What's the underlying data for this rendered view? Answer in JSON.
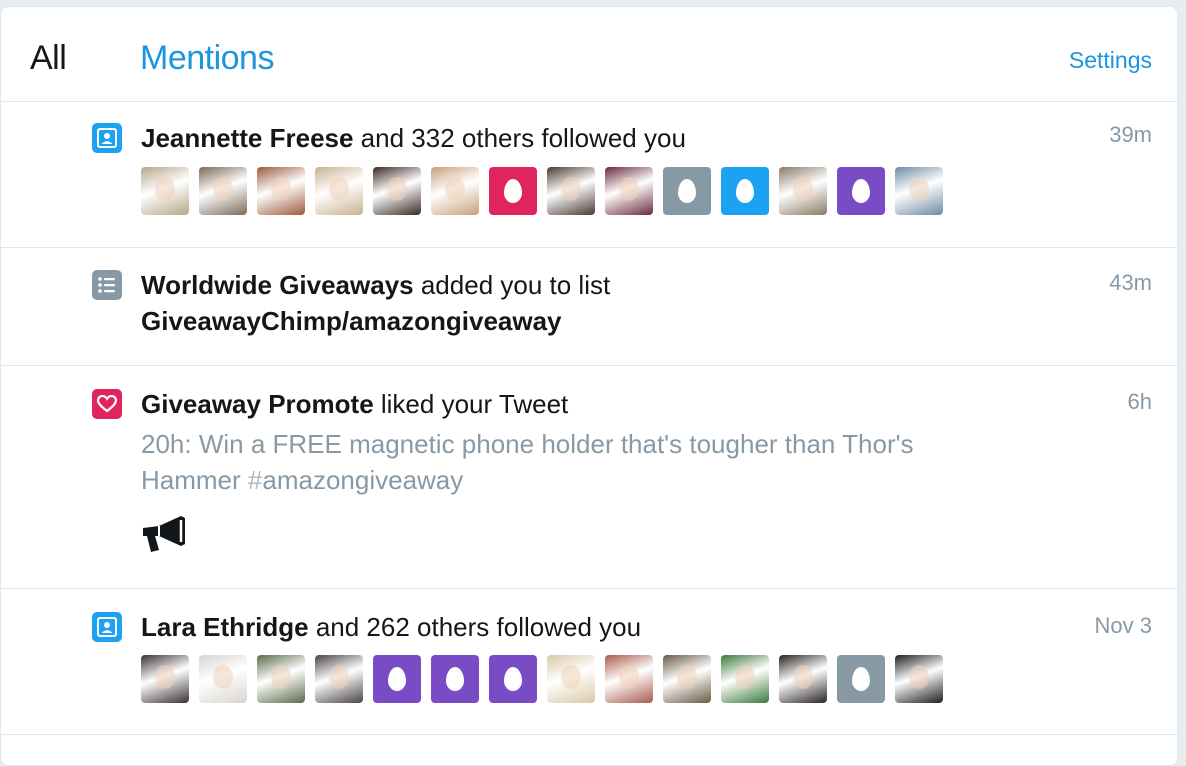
{
  "tabs": {
    "all": "All",
    "mentions": "Mentions",
    "settings": "Settings"
  },
  "notifications": [
    {
      "type": "follow",
      "icon": "person-icon",
      "actor": "Jeannette Freese",
      "text": " and 332 others followed you",
      "time": "39m",
      "avatars": [
        {
          "kind": "photo",
          "color": "#b9a58a"
        },
        {
          "kind": "photo",
          "color": "#7a6a58"
        },
        {
          "kind": "photo",
          "color": "#9b5a3a"
        },
        {
          "kind": "photo",
          "color": "#c9b18f"
        },
        {
          "kind": "photo",
          "color": "#3b2a25"
        },
        {
          "kind": "photo",
          "color": "#c8a07a"
        },
        {
          "kind": "egg",
          "color": "#e0245e"
        },
        {
          "kind": "photo",
          "color": "#4a3a33"
        },
        {
          "kind": "photo",
          "color": "#6b2a3a"
        },
        {
          "kind": "egg",
          "color": "#8899a6"
        },
        {
          "kind": "egg",
          "color": "#1da1f2"
        },
        {
          "kind": "photo",
          "color": "#8a7a64"
        },
        {
          "kind": "egg",
          "color": "#794bc4"
        },
        {
          "kind": "photo",
          "color": "#6d8aa6"
        }
      ]
    },
    {
      "type": "list",
      "icon": "list-icon",
      "actor": "Worldwide Giveaways",
      "text": " added you to list",
      "list_name": "GiveawayChimp/amazongiveaway",
      "time": "43m"
    },
    {
      "type": "like",
      "icon": "heart-icon",
      "actor": "Giveaway Promote",
      "text": " liked your Tweet",
      "tweet_line1": "20h: Win a FREE magnetic phone holder that's tougher than Thor's",
      "tweet_line2": "Hammer ",
      "hashtag_mark": "#",
      "hashtag_word": "amazongiveaway",
      "time": "6h",
      "media_icon": "megaphone-icon"
    },
    {
      "type": "follow",
      "icon": "person-icon",
      "actor": "Lara Ethridge",
      "text": " and 262 others followed you",
      "time": "Nov 3",
      "avatars": [
        {
          "kind": "photo",
          "color": "#3a3033"
        },
        {
          "kind": "photo",
          "color": "#d8d4d0"
        },
        {
          "kind": "photo",
          "color": "#5a6a4a"
        },
        {
          "kind": "photo",
          "color": "#4a4446"
        },
        {
          "kind": "egg",
          "color": "#794bc4"
        },
        {
          "kind": "egg",
          "color": "#794bc4"
        },
        {
          "kind": "egg",
          "color": "#794bc4"
        },
        {
          "kind": "photo",
          "color": "#d8c8a8"
        },
        {
          "kind": "photo",
          "color": "#a85a4a"
        },
        {
          "kind": "photo",
          "color": "#6a5a44"
        },
        {
          "kind": "photo",
          "color": "#3a7a3a"
        },
        {
          "kind": "photo",
          "color": "#2a2424"
        },
        {
          "kind": "egg",
          "color": "#8899a6"
        },
        {
          "kind": "photo",
          "color": "#1e1e1e"
        }
      ]
    }
  ],
  "colors": {
    "accent": "#1b95e0",
    "muted": "#8899a6",
    "border": "#e1e8ed"
  }
}
